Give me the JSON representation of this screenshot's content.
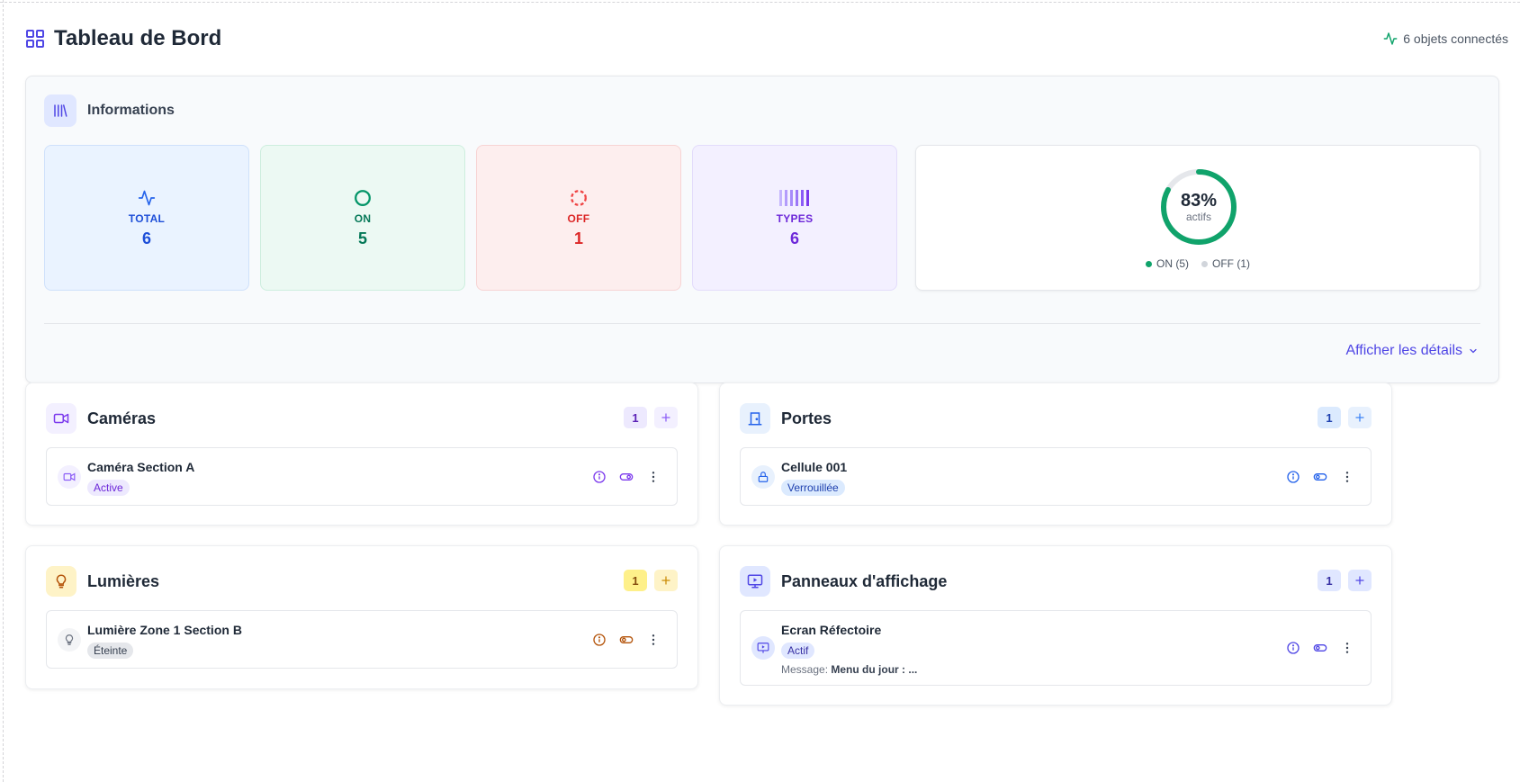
{
  "header": {
    "title": "Tableau de Bord",
    "connected_label": "6 objets connectés"
  },
  "info": {
    "title": "Informations",
    "stats": [
      {
        "key": "total",
        "label": "TOTAL",
        "value": "6",
        "icon": "activity-icon"
      },
      {
        "key": "on",
        "label": "ON",
        "value": "5",
        "icon": "circle-icon"
      },
      {
        "key": "off",
        "label": "OFF",
        "value": "1",
        "icon": "dashed-circle-icon"
      },
      {
        "key": "types",
        "label": "TYPES",
        "value": "6",
        "icon": "bars-icon"
      }
    ],
    "donut": {
      "percent_label": "83%",
      "sub_label": "actifs",
      "active_fraction": 0.83,
      "legend_on": "ON (5)",
      "legend_off": "OFF (1)"
    },
    "details_label": "Afficher les détails"
  },
  "colors": {
    "accent": "#4f46e5",
    "on": "#10a36b",
    "off": "#d1d5db",
    "camera": "#7c3aed",
    "door": "#2563eb",
    "light": "#b45309",
    "display": "#4f46e5"
  },
  "categories": {
    "cameras": {
      "title": "Caméras",
      "count": "1",
      "icon": "video-camera-icon",
      "devices": [
        {
          "name": "Caméra Section A",
          "status": "Active"
        }
      ]
    },
    "doors": {
      "title": "Portes",
      "count": "1",
      "icon": "door-icon",
      "devices": [
        {
          "name": "Cellule 001",
          "status": "Verrouillée"
        }
      ]
    },
    "lights": {
      "title": "Lumières",
      "count": "1",
      "icon": "lightbulb-icon",
      "devices": [
        {
          "name": "Lumière Zone 1 Section B",
          "status": "Éteinte"
        }
      ]
    },
    "displays": {
      "title": "Panneaux d'affichage",
      "count": "1",
      "icon": "presentation-screen-icon",
      "devices": [
        {
          "name": "Ecran Réfectoire",
          "status": "Actif",
          "message_label": "Message:",
          "message": "Menu du jour : ..."
        }
      ]
    }
  }
}
